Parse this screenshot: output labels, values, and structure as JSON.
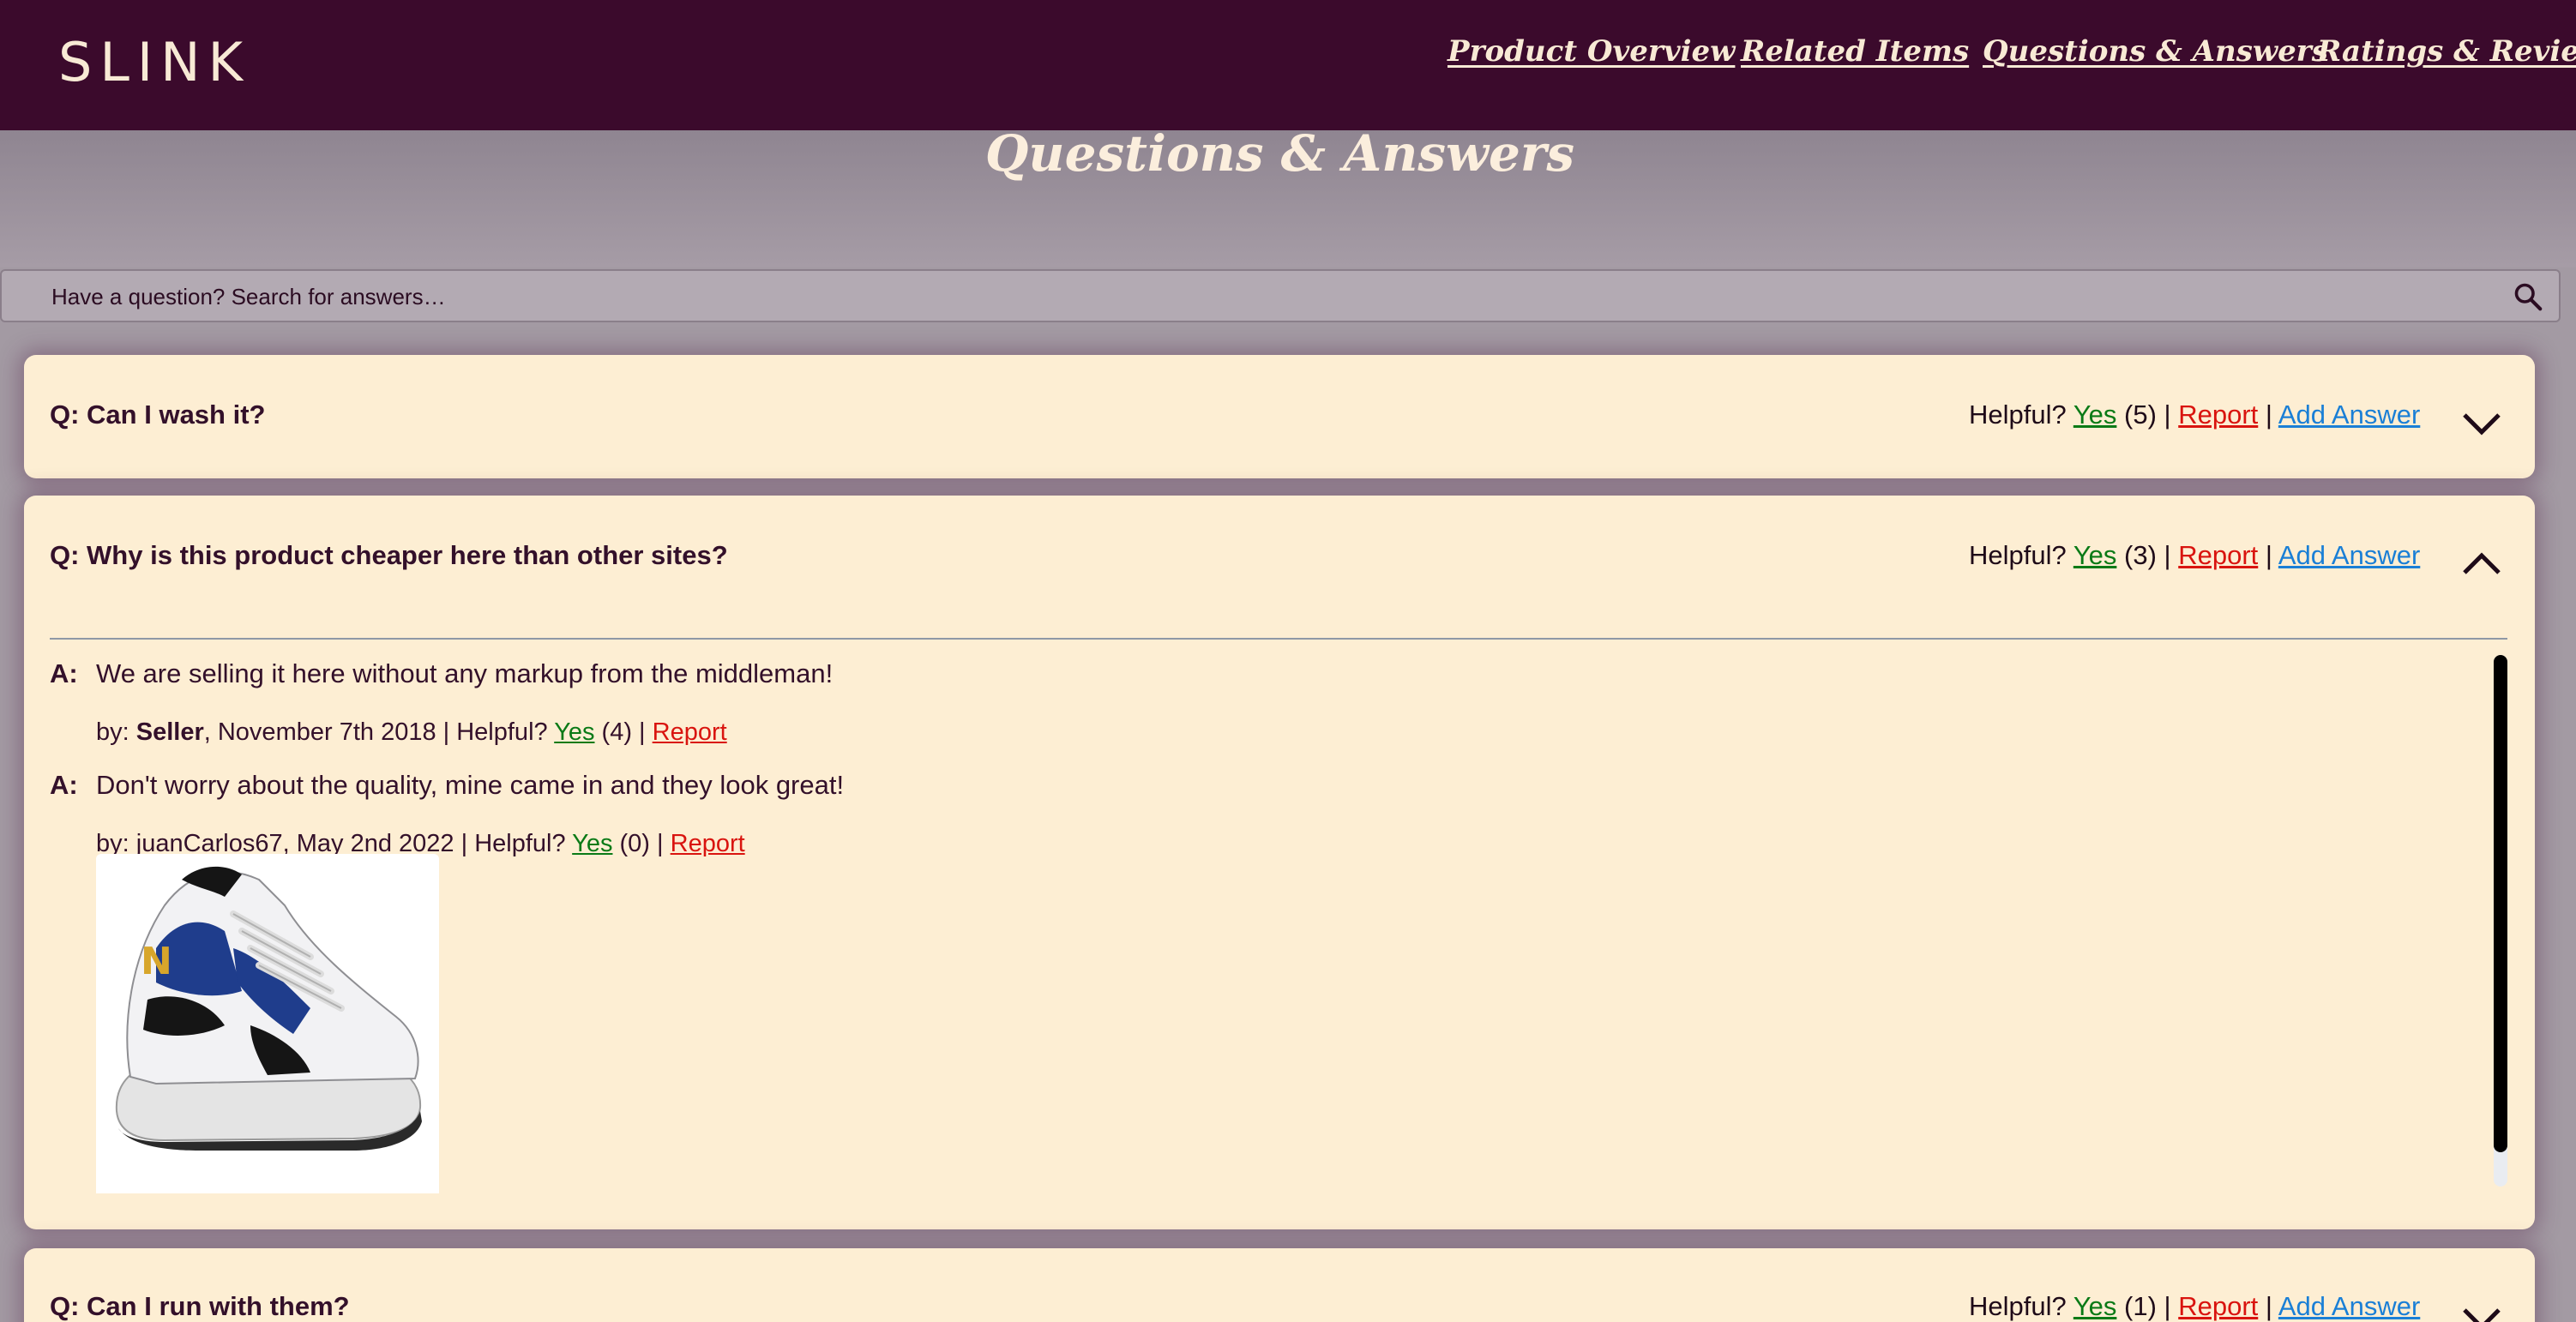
{
  "header": {
    "logo": "SLINK",
    "nav": [
      {
        "label": "Product Overview"
      },
      {
        "label": "Related Items"
      },
      {
        "label": "Questions & Answers"
      },
      {
        "label": "Ratings & Reviews"
      }
    ]
  },
  "section": {
    "title": "Questions & Answers"
  },
  "search": {
    "placeholder": "Have a question? Search for answers…",
    "icon": "search-icon"
  },
  "helpful_label": "Helpful?",
  "yes_label": "Yes",
  "report_label": "Report",
  "add_answer_label": "Add Answer",
  "questions": [
    {
      "text": "Q: Can I wash it?",
      "helpful_count": "(5)",
      "expanded": false
    },
    {
      "text": "Q: Why is this product cheaper here than other sites?",
      "helpful_count": "(3)",
      "expanded": true,
      "answers": [
        {
          "label": "A:",
          "body": "We are selling it here without any markup from the middleman!",
          "by_prefix": "by: ",
          "author": "Seller",
          "date": ", November 7th 2018 | ",
          "helpful_count": " (4) | "
        },
        {
          "label": "A:",
          "body": "Don't worry about the quality, mine came in and they look great!",
          "by_prefix": "by: ",
          "author": "juanCarlos67",
          "date": ", May 2nd 2022 | ",
          "helpful_count": " (0) | ",
          "photo": "sneaker-photo"
        }
      ]
    },
    {
      "text": "Q: Can I run with them?",
      "helpful_count": "(1)",
      "expanded": false
    }
  ],
  "colors": {
    "header_bg": "#3b0a2c",
    "card_bg": "#fdeed3",
    "yes": "#0a7a16",
    "report": "#d9140f",
    "add_answer": "#1a7fd6"
  }
}
